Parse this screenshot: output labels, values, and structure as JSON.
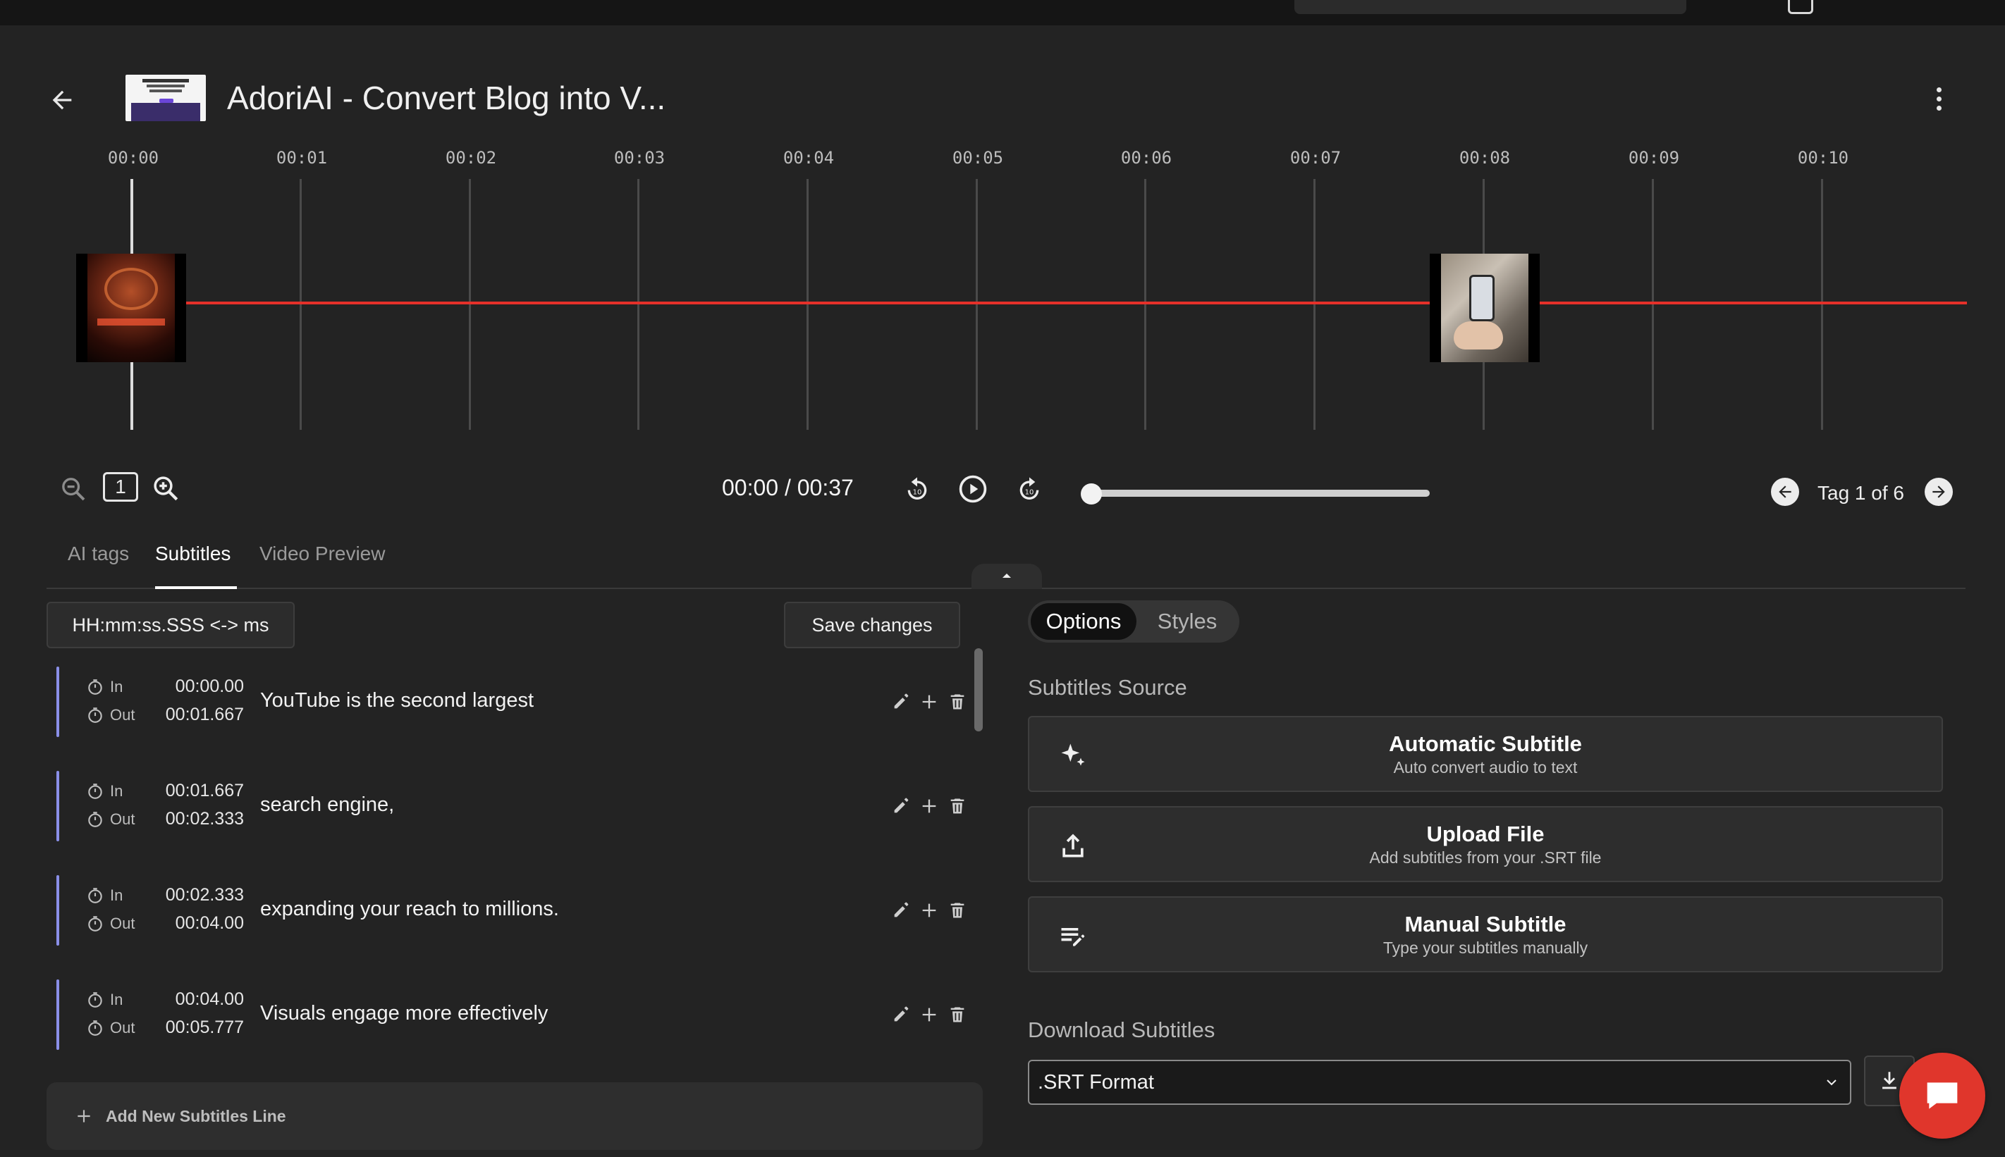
{
  "header": {
    "title": "AdoriAI - Convert Blog into V..."
  },
  "timeline": {
    "ticks": [
      "00:00",
      "00:01",
      "00:02",
      "00:03",
      "00:04",
      "00:05",
      "00:06",
      "00:07",
      "00:08",
      "00:09",
      "00:10"
    ]
  },
  "controls": {
    "zoom_level": "1",
    "timecode": "00:00 / 00:37",
    "tag_counter": "Tag 1 of 6"
  },
  "tabs": [
    {
      "label": "AI tags"
    },
    {
      "label": "Subtitles"
    },
    {
      "label": "Video Preview"
    }
  ],
  "subtitles": {
    "format_toggle": "HH:mm:ss.SSS <-> ms",
    "save_label": "Save changes",
    "in_label": "In",
    "out_label": "Out",
    "rows": [
      {
        "in": "00:00.00",
        "out": "00:01.667",
        "text": "YouTube is the second largest"
      },
      {
        "in": "00:01.667",
        "out": "00:02.333",
        "text": "search engine,"
      },
      {
        "in": "00:02.333",
        "out": "00:04.00",
        "text": "expanding your reach to millions."
      },
      {
        "in": "00:04.00",
        "out": "00:05.777",
        "text": "Visuals engage more effectively"
      }
    ],
    "add_line_label": "Add New Subtitles Line"
  },
  "panel": {
    "segments": [
      {
        "label": "Options"
      },
      {
        "label": "Styles"
      }
    ],
    "source_heading": "Subtitles Source",
    "sources": [
      {
        "title": "Automatic Subtitle",
        "subtitle": "Auto convert audio to text",
        "icon": "sparkle-icon"
      },
      {
        "title": "Upload File",
        "subtitle": "Add subtitles from your .SRT file",
        "icon": "upload-icon"
      },
      {
        "title": "Manual Subtitle",
        "subtitle": "Type your subtitles manually",
        "icon": "edit-list-icon"
      }
    ],
    "download_heading": "Download Subtitles",
    "download_format": ".SRT Format"
  },
  "colors": {
    "background": "#232323",
    "timeline_accent": "#e5302a",
    "subtitle_bar": "#8a8fe8",
    "chat_button": "#e0362c"
  }
}
